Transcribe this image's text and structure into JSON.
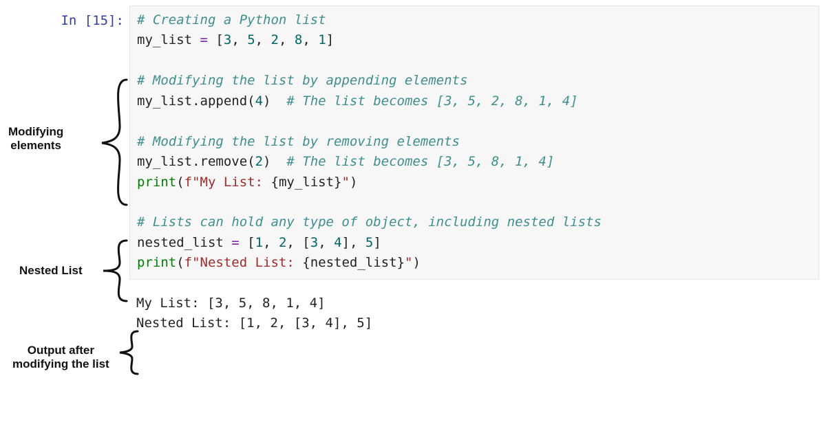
{
  "prompt": "In [15]:",
  "code": {
    "l1_comment": "# Creating a Python list",
    "l2_a": "my_list ",
    "l2_eq": "= ",
    "l2_b": "[",
    "l2_n1": "3",
    "l2_c1": ", ",
    "l2_n2": "5",
    "l2_c2": ", ",
    "l2_n3": "2",
    "l2_c3": ", ",
    "l2_n4": "8",
    "l2_c4": ", ",
    "l2_n5": "1",
    "l2_close": "]",
    "l4_comment": "# Modifying the list by appending elements",
    "l5_a": "my_list.append(",
    "l5_n": "4",
    "l5_b": ")  ",
    "l5_comment": "# The list becomes [3, 5, 2, 8, 1, 4]",
    "l7_comment": "# Modifying the list by removing elements",
    "l8_a": "my_list.remove(",
    "l8_n": "2",
    "l8_b": ")  ",
    "l8_comment": "# The list becomes [3, 5, 8, 1, 4]",
    "l9_kw": "print",
    "l9_a": "(",
    "l9_f": "f\"My List: ",
    "l9_i_open": "{",
    "l9_i_expr": "my_list",
    "l9_i_close": "}",
    "l9_f_end": "\"",
    "l9_b": ")",
    "l11_comment": "# Lists can hold any type of object, including nested lists",
    "l12_a": "nested_list ",
    "l12_eq": "= ",
    "l12_b": "[",
    "l12_n1": "1",
    "l12_c1": ", ",
    "l12_n2": "2",
    "l12_c2": ", [",
    "l12_n3": "3",
    "l12_c3": ", ",
    "l12_n4": "4",
    "l12_c4": "], ",
    "l12_n5": "5",
    "l12_close": "]",
    "l13_kw": "print",
    "l13_a": "(",
    "l13_f": "f\"Nested List: ",
    "l13_i_open": "{",
    "l13_i_expr": "nested_list",
    "l13_i_close": "}",
    "l13_f_end": "\"",
    "l13_b": ")"
  },
  "output": {
    "line1": "My List: [3, 5, 8, 1, 4]",
    "line2": "Nested List: [1, 2, [3, 4], 5]"
  },
  "annotations": {
    "modifying": "Modifying\nelements",
    "nested": "Nested List",
    "output": "Output after\nmodifying the list"
  }
}
